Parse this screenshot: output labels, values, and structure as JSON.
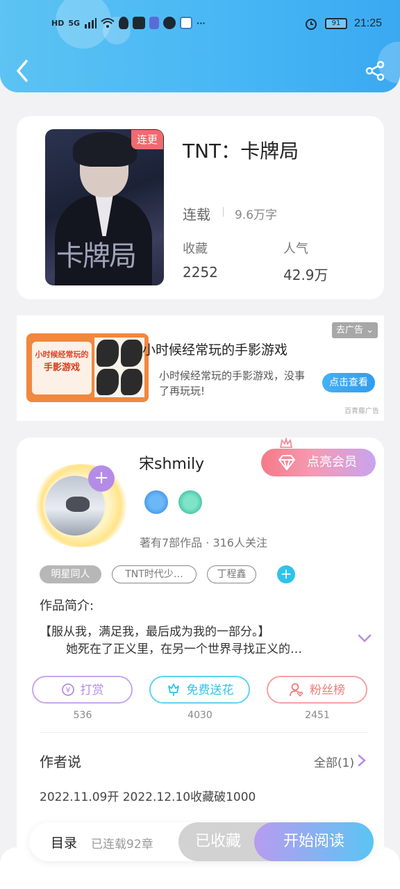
{
  "status_bar": {
    "left_text": "HD",
    "network": "5G",
    "more": "···",
    "battery": "91",
    "time": "21:25"
  },
  "book": {
    "badge": "连更",
    "title": "TNT：卡牌局",
    "cover_title": "卡牌局",
    "status": "连载",
    "words": "9.6万字",
    "collect_label": "收藏",
    "collect_value": "2252",
    "popularity_label": "人气",
    "popularity_value": "42.9万"
  },
  "ad": {
    "close_label": "去广告 ⌄",
    "title": "小时候经常玩的手影游戏",
    "description": "小时候经常玩的手影游戏，没事了再玩玩!",
    "button": "点击查看",
    "source": "百青藤广告",
    "image_text_1": "小时候经常玩的",
    "image_text_2": "手影游戏"
  },
  "author": {
    "name": "宋shmily",
    "vip_button": "点亮会员",
    "meta": "著有7部作品 · 316人关注",
    "tags": [
      "明星同人",
      "TNT时代少…",
      "丁程鑫"
    ],
    "intro_label": "作品简介:",
    "intro_line1": "【服从我，满足我，最后成为我的一部分。】",
    "intro_line2": "她死在了正义里，在另一个世界寻找正义的…",
    "actions": [
      {
        "label": "打赏",
        "count": "536"
      },
      {
        "label": "免费送花",
        "count": "4030"
      },
      {
        "label": "粉丝榜",
        "count": "2451"
      }
    ],
    "say_label": "作者说",
    "say_all": "全部(1)",
    "say_text": "2022.11.09开 2022.12.10收藏破1000"
  },
  "bottom": {
    "toc_label": "目录",
    "toc_count": "已连载92章",
    "collected": "已收藏",
    "read": "开始阅读"
  },
  "colors": {
    "header": "#47b6f4",
    "update_badge": "#f06a6e",
    "reward": "#b48ce8",
    "flower": "#2fc3ea",
    "fans": "#f07a7a"
  }
}
